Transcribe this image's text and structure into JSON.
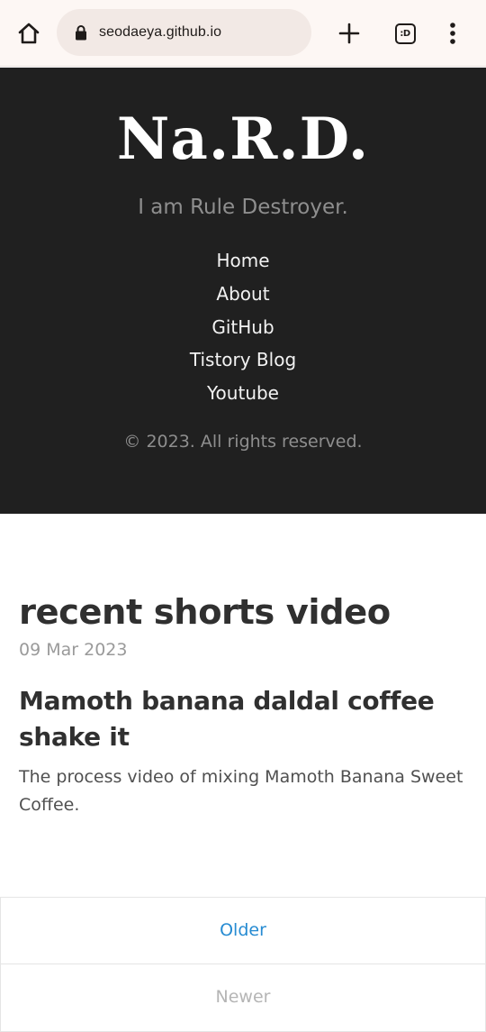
{
  "browser": {
    "url": "seodaeya.github.io",
    "tab_switcher_label": ":D",
    "icons": {
      "home": "home-icon",
      "lock": "lock-icon",
      "new_tab": "plus-icon",
      "tabs": "tab-switcher-icon",
      "menu": "more-vert-icon"
    },
    "toolbar_bg": "#fdf7f4",
    "omnibox_bg": "#f2e9e5"
  },
  "header": {
    "title": "Na.R.D.",
    "tagline": "I am Rule Destroyer.",
    "nav": [
      {
        "label": "Home"
      },
      {
        "label": "About"
      },
      {
        "label": "GitHub"
      },
      {
        "label": "Tistory Blog"
      },
      {
        "label": "Youtube"
      }
    ],
    "copyright": "© 2023. All rights reserved.",
    "bg_color": "#202020"
  },
  "main": {
    "section_title": "recent shorts video",
    "post": {
      "date": "09 Mar 2023",
      "title": "Mamoth banana daldal coffee shake it",
      "excerpt": "The process video of mixing Mamoth Banana Sweet Coffee."
    }
  },
  "pagination": {
    "older_label": "Older",
    "newer_label": "Newer",
    "link_color": "#268bd2",
    "disabled_color": "#b5b5b5"
  }
}
